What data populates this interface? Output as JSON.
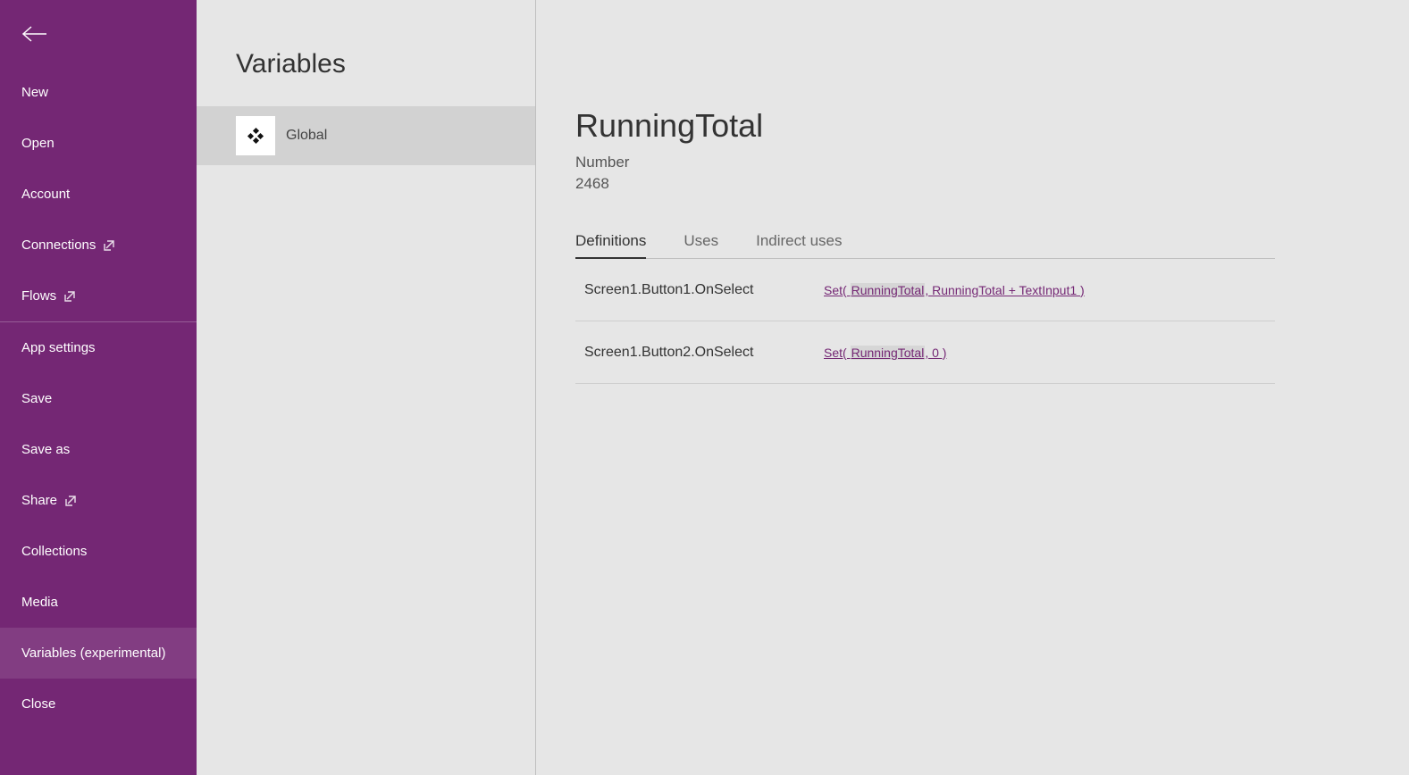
{
  "sidebar": {
    "items": [
      {
        "label": "New",
        "name": "nav-new",
        "external": false
      },
      {
        "label": "Open",
        "name": "nav-open",
        "external": false
      },
      {
        "label": "Account",
        "name": "nav-account",
        "external": false
      },
      {
        "label": "Connections",
        "name": "nav-connections",
        "external": true
      },
      {
        "label": "Flows",
        "name": "nav-flows",
        "external": true
      },
      {
        "label": "App settings",
        "name": "nav-app-settings",
        "external": false
      },
      {
        "label": "Save",
        "name": "nav-save",
        "external": false
      },
      {
        "label": "Save as",
        "name": "nav-save-as",
        "external": false
      },
      {
        "label": "Share",
        "name": "nav-share",
        "external": true
      },
      {
        "label": "Collections",
        "name": "nav-collections",
        "external": false
      },
      {
        "label": "Media",
        "name": "nav-media",
        "external": false
      },
      {
        "label": "Variables (experimental)",
        "name": "nav-variables",
        "external": false,
        "active": true
      },
      {
        "label": "Close",
        "name": "nav-close",
        "external": false
      }
    ]
  },
  "middle": {
    "title": "Variables",
    "scopes": [
      {
        "label": "Global",
        "icon": "global-icon",
        "selected": true
      }
    ]
  },
  "detail": {
    "name": "RunningTotal",
    "type": "Number",
    "value": "2468",
    "tabs": [
      {
        "label": "Definitions",
        "name": "tab-definitions",
        "active": true
      },
      {
        "label": "Uses",
        "name": "tab-uses",
        "active": false
      },
      {
        "label": "Indirect uses",
        "name": "tab-indirect-uses",
        "active": false
      }
    ],
    "definitions": [
      {
        "location": "Screen1.Button1.OnSelect",
        "formula_pre": "Set( ",
        "formula_hl": "RunningTotal",
        "formula_post": ", RunningTotal + TextInput1 )"
      },
      {
        "location": "Screen1.Button2.OnSelect",
        "formula_pre": "Set( ",
        "formula_hl": "RunningTotal",
        "formula_post": ", 0 )"
      }
    ]
  }
}
